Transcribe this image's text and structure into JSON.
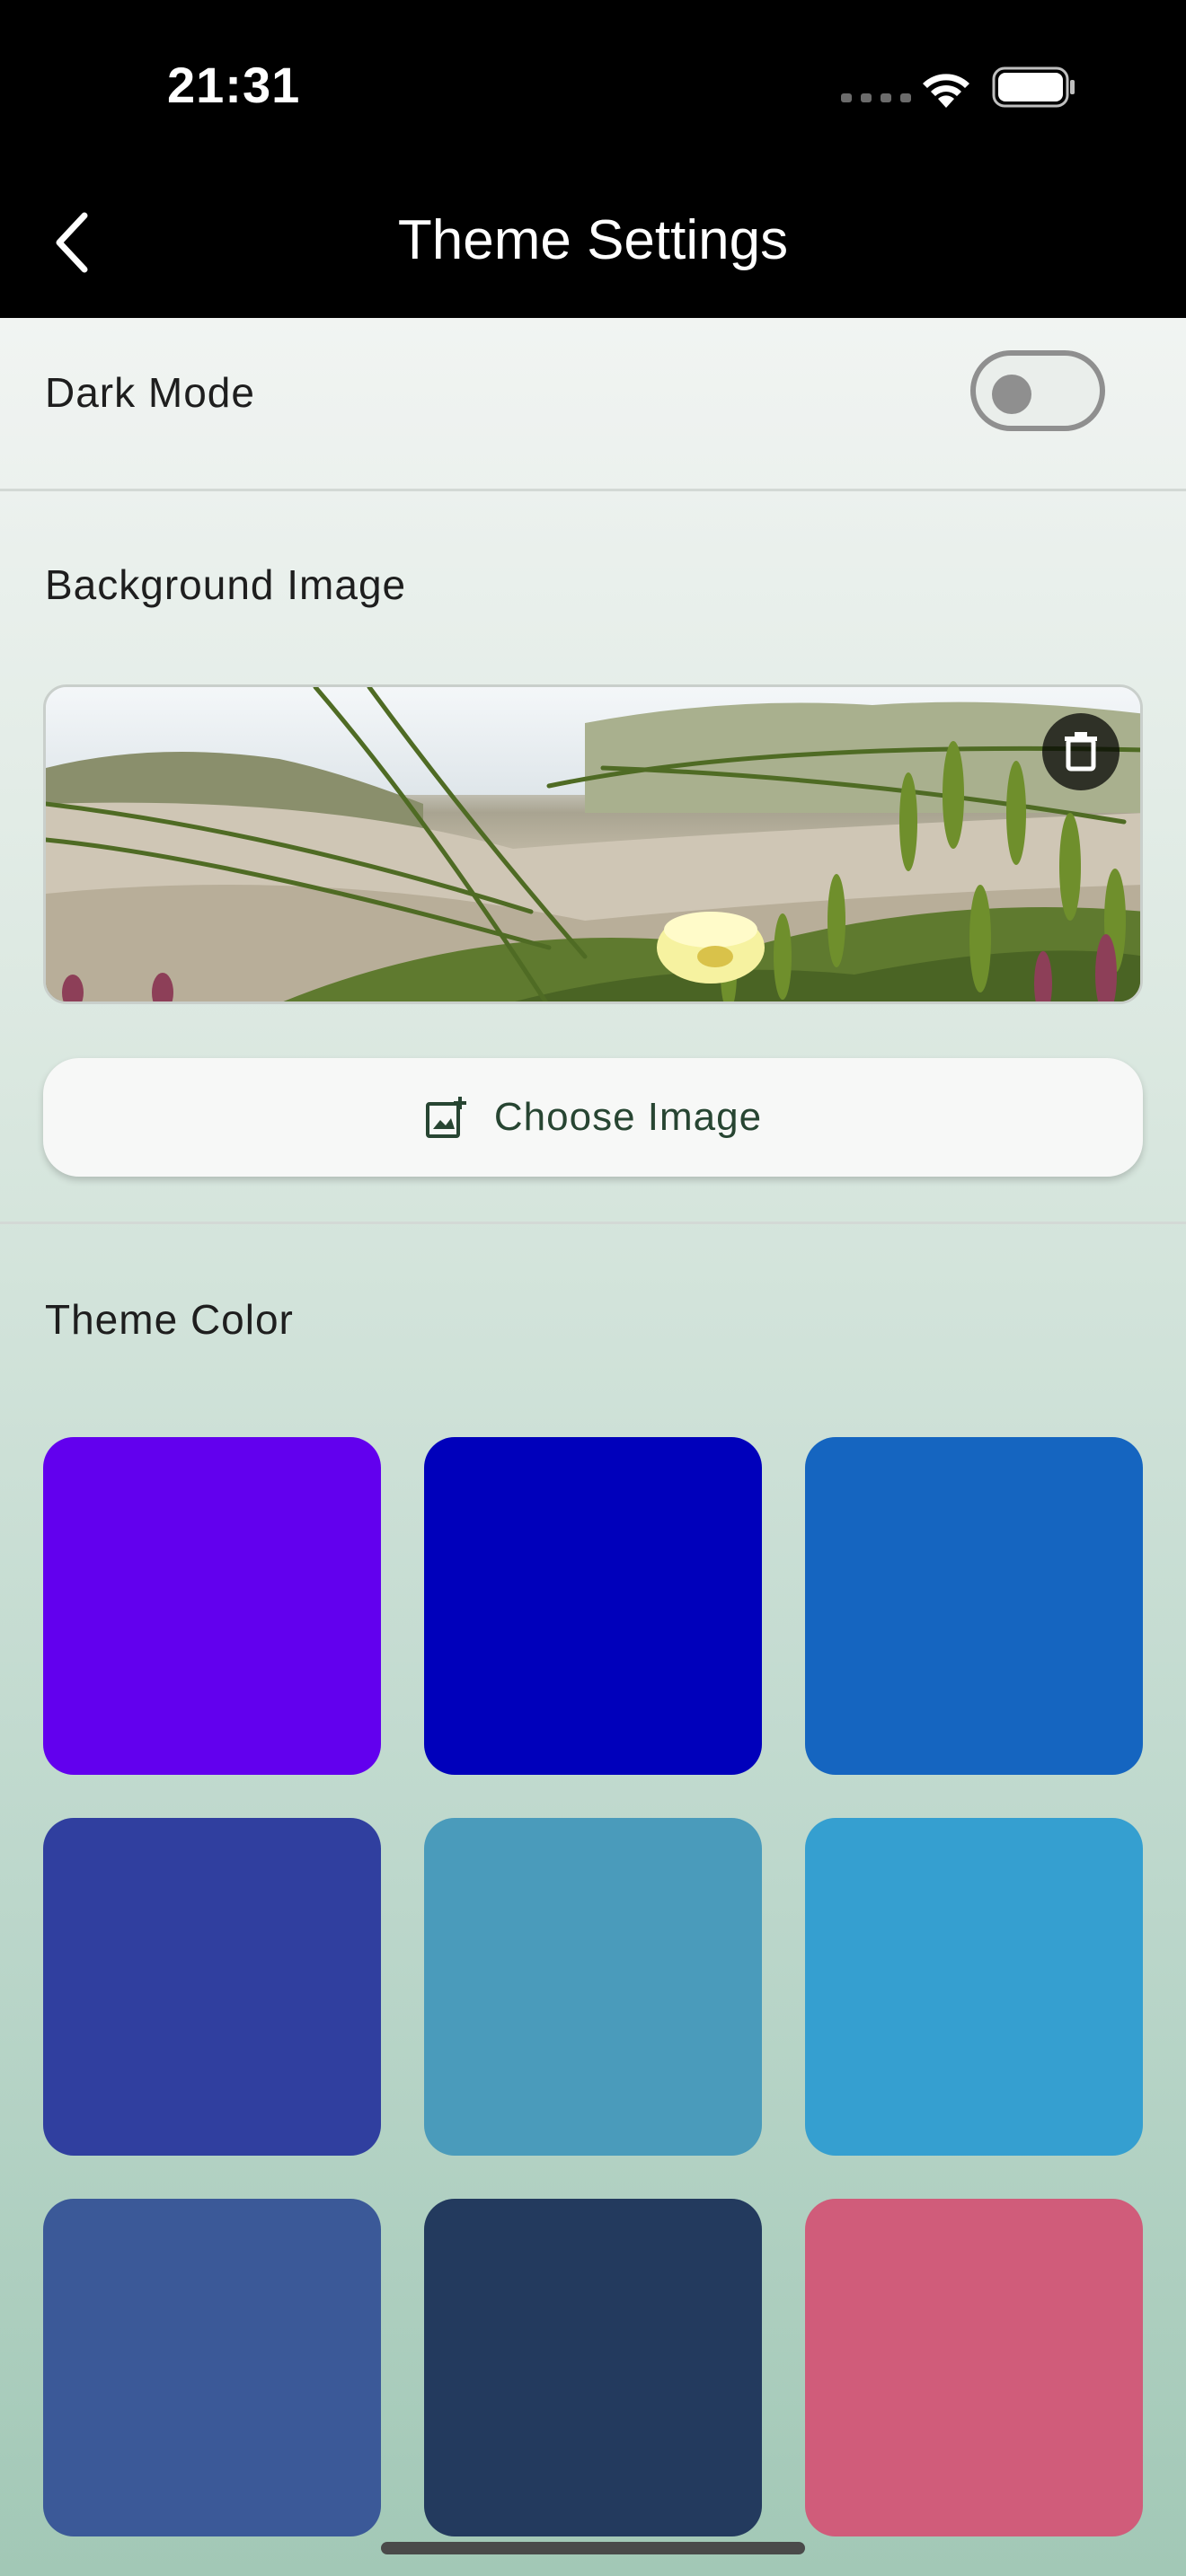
{
  "status_bar": {
    "time": "21:31",
    "icons": [
      "cellular-dots-icon",
      "wifi-icon",
      "battery-icon"
    ]
  },
  "app_bar": {
    "title": "Theme Settings",
    "back_icon": "chevron-left-icon"
  },
  "dark_mode": {
    "label": "Dark Mode",
    "enabled": false
  },
  "background_image": {
    "label": "Background Image",
    "image_description": "photo",
    "delete_icon": "trash-icon",
    "choose_button_label": "Choose Image",
    "choose_button_icon": "add-photo-icon"
  },
  "theme_color": {
    "label": "Theme Color",
    "swatches": [
      "#6200EE",
      "#0000BB",
      "#1565C0",
      "#303F9F",
      "#4A9BBB",
      "#359FD0",
      "#3B5998",
      "#233A5E",
      "#D05C7A"
    ]
  },
  "colors": {
    "accent_text": "#274532",
    "app_bar_bg": "#000000"
  }
}
